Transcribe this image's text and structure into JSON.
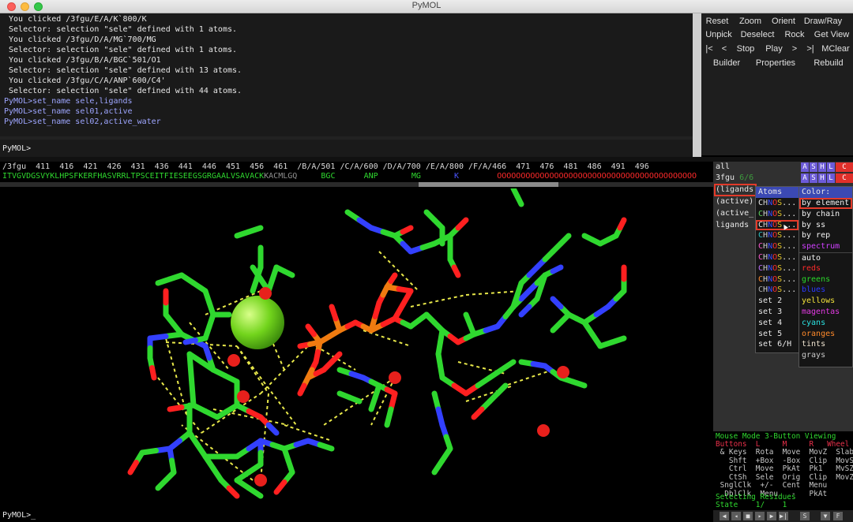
{
  "window": {
    "title": "PyMOL"
  },
  "console": {
    "lines": [
      {
        "text": " You clicked /3fgu/E/A/K`800/K",
        "type": "out"
      },
      {
        "text": " Selector: selection \"sele\" defined with 1 atoms.",
        "type": "out"
      },
      {
        "text": " You clicked /3fgu/D/A/MG`700/MG",
        "type": "out"
      },
      {
        "text": " Selector: selection \"sele\" defined with 1 atoms.",
        "type": "out"
      },
      {
        "text": " You clicked /3fgu/B/A/BGC`501/O1",
        "type": "out"
      },
      {
        "text": " Selector: selection \"sele\" defined with 13 atoms.",
        "type": "out"
      },
      {
        "text": " You clicked /3fgu/C/A/ANP`600/C4'",
        "type": "out"
      },
      {
        "text": " Selector: selection \"sele\" defined with 44 atoms.",
        "type": "out"
      },
      {
        "text": "PyMOL>set_name sele,ligands",
        "type": "cmd"
      },
      {
        "text": "PyMOL>set_name sel01,active",
        "type": "cmd"
      },
      {
        "text": "PyMOL>set_name sel02,active_water",
        "type": "cmd"
      }
    ],
    "prompt": "PyMOL>"
  },
  "controls": {
    "row1": [
      "Reset",
      "Zoom",
      "Orient",
      "Draw/Ray"
    ],
    "row2": [
      "Unpick",
      "Deselect",
      "Rock",
      "Get View"
    ],
    "row3": [
      "|<",
      "<",
      "Stop",
      "Play",
      ">",
      ">|",
      "MClear"
    ],
    "row4": [
      "Builder",
      "Properties",
      "Rebuild"
    ]
  },
  "sequence": {
    "numbers": "/3fgu  411  416  421  426  431  436  441  446  451  456  461  /B/A/501 /C/A/600 /D/A/700 /E/A/800 /F/A/466  471  476  481  486  491  496",
    "residues_green": "ITVGVDGSVYKLHPSFKERFHASVRRLTPSCEITFIESEEGSGRGAALVSAVACK",
    "residues_gray": "KACMLGQ",
    "ligand_bgc": "BGC",
    "ligand_anp": "ANP",
    "ligand_mg": "MG",
    "ligand_k": "K",
    "residues_red": "OOOOOOOOOOOOOOOOOOOOOOOOOOOOOOOOOOOOOOOOOO"
  },
  "objects": [
    {
      "name": "all",
      "dim": ""
    },
    {
      "name": "3fgu",
      "dim": " 6/6"
    },
    {
      "name": "(ligands)",
      "dim": ""
    },
    {
      "name": "(active)",
      "dim": ""
    },
    {
      "name": "(active_",
      "dim": ""
    },
    {
      "name": "ligands",
      "dim": ""
    }
  ],
  "object_buttons": [
    "A",
    "S",
    "H",
    "L",
    "C"
  ],
  "atoms_menu": {
    "header": "Atoms",
    "items": [
      {
        "text": "HNOS...",
        "colors": [
          "#cccccc",
          "#3b4bff",
          "#ff3030",
          "#e6c82a"
        ],
        "lead": "C"
      },
      {
        "text": "HNOS...",
        "colors": [
          "#cccccc",
          "#3b4bff",
          "#ff3030",
          "#e6c82a"
        ],
        "lead": "C"
      },
      {
        "text": "HNOS...",
        "colors": [
          "#cccccc",
          "#3b4bff",
          "#ff3030",
          "#e6c82a"
        ],
        "lead": "C"
      },
      {
        "text": "HNOS...",
        "colors": [
          "#cccccc",
          "#3b4bff",
          "#ff3030",
          "#e6c82a"
        ],
        "lead": "C"
      },
      {
        "text": "HNOS...",
        "colors": [
          "#cccccc",
          "#3b4bff",
          "#ff3030",
          "#e6c82a"
        ],
        "lead": "C"
      },
      {
        "text": "HNOS...",
        "colors": [
          "#cccccc",
          "#3b4bff",
          "#ff3030",
          "#e6c82a"
        ],
        "lead": "C"
      },
      {
        "text": "HNOS...",
        "colors": [
          "#cccccc",
          "#3b4bff",
          "#ff3030",
          "#e6c82a"
        ],
        "lead": "C"
      },
      {
        "text": "HNOS...",
        "colors": [
          "#cccccc",
          "#3b4bff",
          "#ff3030",
          "#e6c82a"
        ],
        "lead": "C"
      },
      {
        "text": "HNOS...",
        "colors": [
          "#cccccc",
          "#3b4bff",
          "#ff3030",
          "#e6c82a"
        ],
        "lead": "C"
      }
    ],
    "lead_colors": [
      "#e8e8e8",
      "#5fd55f",
      "#f2f2f2",
      "#2ec4c4",
      "#ff5ad1",
      "#ff5ad1",
      "#c070ff",
      "#ff8a30",
      "#b0b0b0"
    ],
    "sets": [
      "set 2",
      "set 3",
      "set 4",
      "set 5",
      "set 6/H"
    ]
  },
  "color_menu": {
    "header": "Color:",
    "items": [
      {
        "text": "by element",
        "color": "#f2f2f2"
      },
      {
        "text": "by chain",
        "color": "#f2f2f2"
      },
      {
        "text": "by ss",
        "color": "#f2f2f2"
      },
      {
        "text": "by rep",
        "color": "#f2f2f2"
      },
      {
        "text": "spectrum",
        "color": "#d040ff"
      },
      {
        "text": "auto",
        "color": "#f2f2f2"
      },
      {
        "text": "reds",
        "color": "#ff2a2a"
      },
      {
        "text": "greens",
        "color": "#2ad82a"
      },
      {
        "text": "blues",
        "color": "#2a3aff"
      },
      {
        "text": "yellows",
        "color": "#f2e23a"
      },
      {
        "text": "magentas",
        "color": "#e23ae2"
      },
      {
        "text": "cyans",
        "color": "#2ae2e2"
      },
      {
        "text": "oranges",
        "color": "#ff8a2a"
      },
      {
        "text": "tints",
        "color": "#f0e4d0"
      },
      {
        "text": "grays",
        "color": "#c8c8c8"
      }
    ]
  },
  "mouse_panel": {
    "mode_line": "Mouse Mode 3-Button Viewing",
    "buttons_line": "Buttons  L     M     R   Wheel",
    "rows": [
      " & Keys  Rota  Move  MovZ  Slab",
      "   Shft  +Box  -Box  Clip  MovS",
      "   Ctrl  Move  PkAt  Pk1   MvSZ",
      "   CtSh  Sele  Orig  Clip  MovZ",
      " SnglClk  +/-  Cent  Menu",
      "  DblClk  Menu   -   PkAt"
    ],
    "selecting": "Selecting Residues",
    "state": "State    1/    1"
  },
  "state_buttons": [
    "◀",
    "◂",
    "■",
    "▸",
    "▶",
    "▶|",
    "S",
    "▼",
    "F"
  ],
  "bottom_prompt": "PyMOL>_",
  "colors": {
    "carbon": "#2fd82f",
    "nitrogen": "#3340ff",
    "oxygen": "#ff2020",
    "phosphorus": "#f07b10",
    "mg": "#7de02a",
    "hbond": "#e8e84a",
    "water": "#e8201c"
  }
}
